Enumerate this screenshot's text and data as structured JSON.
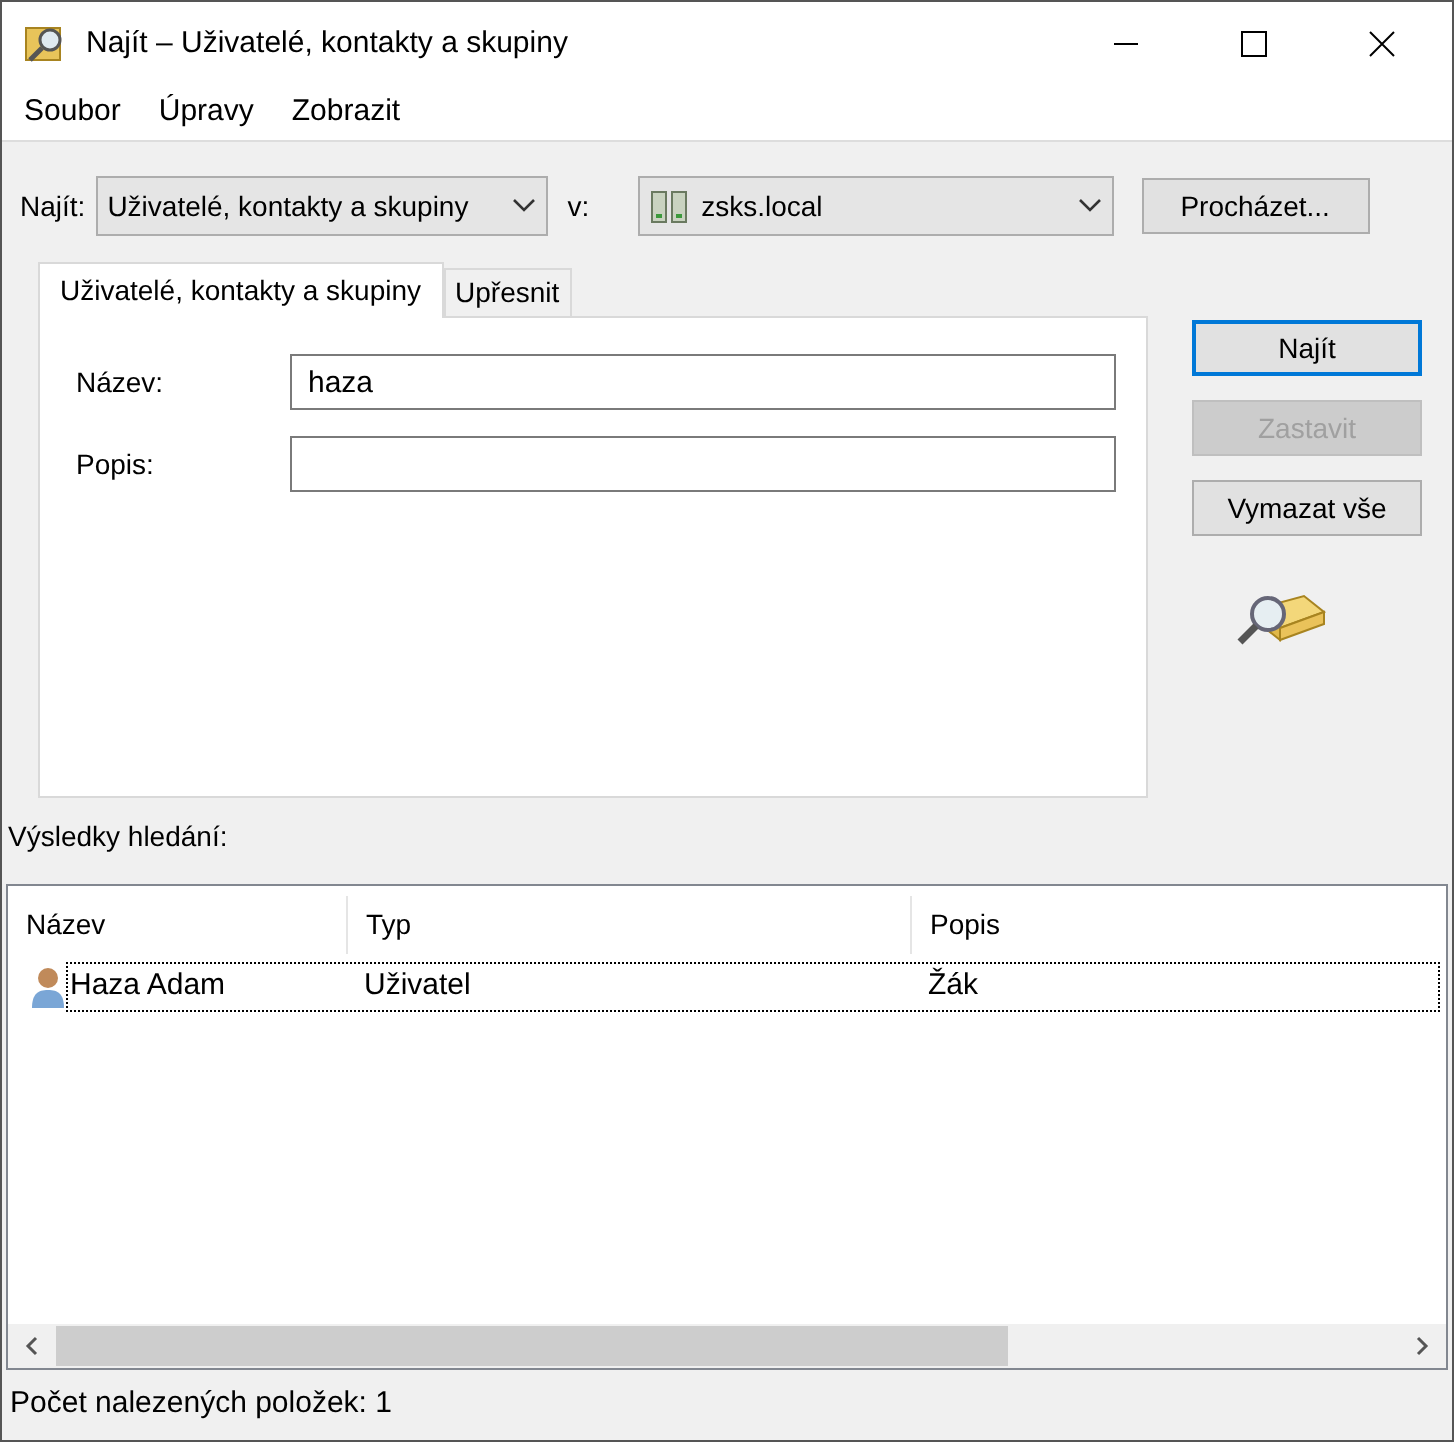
{
  "window": {
    "title": "Najít – Uživatelé, kontakty a skupiny"
  },
  "menu": [
    "Soubor",
    "Úpravy",
    "Zobrazit"
  ],
  "find_row": {
    "find_label": "Najít:",
    "find_value": "Uživatelé, kontakty a skupiny",
    "in_label": "v:",
    "in_value": "zsks.local",
    "browse_button": "Procházet..."
  },
  "tabs": [
    {
      "label": "Uživatelé, kontakty a skupiny",
      "selected": true
    },
    {
      "label": "Upřesnit",
      "selected": false
    }
  ],
  "fields": [
    {
      "label": "Název:",
      "value": "haza"
    },
    {
      "label": "Popis:"
    }
  ],
  "buttons": [
    {
      "label": "Najít",
      "default": true,
      "disabled": false
    },
    {
      "label": "Zastavit",
      "default": false,
      "disabled": true
    },
    {
      "label": "Vymazat vše",
      "default": false,
      "disabled": false
    }
  ],
  "results_label": "Výsledky hledání:",
  "table": {
    "columns": [
      "Název",
      "Typ",
      "Popis"
    ],
    "rows": [
      {
        "cells": [
          "Haza Adam",
          "Uživatel",
          "Žák"
        ],
        "selected": true
      }
    ]
  },
  "status_bar": "Počet nalezených položek: 1"
}
